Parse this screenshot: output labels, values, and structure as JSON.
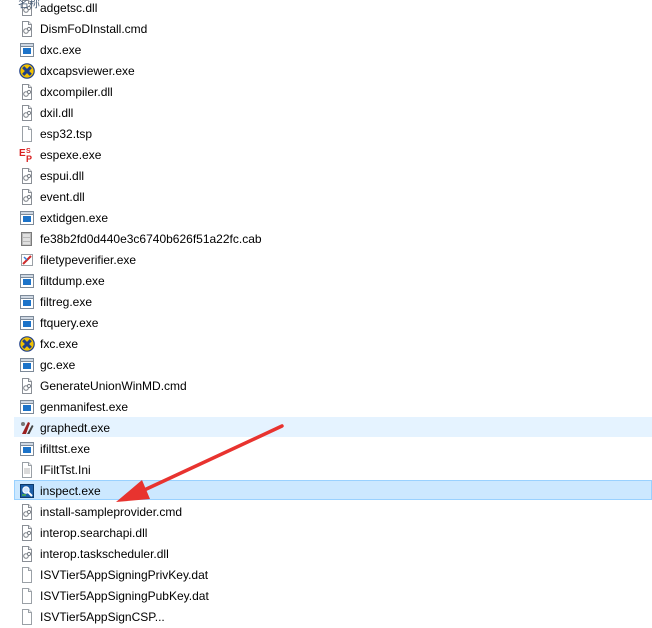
{
  "header": {
    "column_name": "名称"
  },
  "files": [
    {
      "name": "adgetsc.dll",
      "icon": "dll-file-icon",
      "state": "normal"
    },
    {
      "name": "DismFoDInstall.cmd",
      "icon": "cmd-file-icon",
      "state": "normal"
    },
    {
      "name": "dxc.exe",
      "icon": "exe-app-icon",
      "state": "normal"
    },
    {
      "name": "dxcapsviewer.exe",
      "icon": "directx-icon",
      "state": "normal"
    },
    {
      "name": "dxcompiler.dll",
      "icon": "dll-file-icon",
      "state": "normal"
    },
    {
      "name": "dxil.dll",
      "icon": "dll-file-icon",
      "state": "normal"
    },
    {
      "name": "esp32.tsp",
      "icon": "blank-file-icon",
      "state": "normal"
    },
    {
      "name": "espexe.exe",
      "icon": "esp-app-icon",
      "state": "normal"
    },
    {
      "name": "espui.dll",
      "icon": "dll-file-icon",
      "state": "normal"
    },
    {
      "name": "event.dll",
      "icon": "dll-file-icon",
      "state": "normal"
    },
    {
      "name": "extidgen.exe",
      "icon": "exe-app-icon",
      "state": "normal"
    },
    {
      "name": "fe38b2fd0d440e3c6740b626f51a22fc.cab",
      "icon": "cab-archive-icon",
      "state": "normal"
    },
    {
      "name": "filetypeverifier.exe",
      "icon": "verifier-app-icon",
      "state": "normal"
    },
    {
      "name": "filtdump.exe",
      "icon": "exe-app-icon",
      "state": "normal"
    },
    {
      "name": "filtreg.exe",
      "icon": "exe-app-icon",
      "state": "normal"
    },
    {
      "name": "ftquery.exe",
      "icon": "exe-app-icon",
      "state": "normal"
    },
    {
      "name": "fxc.exe",
      "icon": "directx-icon",
      "state": "normal"
    },
    {
      "name": "gc.exe",
      "icon": "exe-app-icon",
      "state": "normal"
    },
    {
      "name": "GenerateUnionWinMD.cmd",
      "icon": "cmd-file-icon",
      "state": "normal"
    },
    {
      "name": "genmanifest.exe",
      "icon": "exe-app-icon",
      "state": "normal"
    },
    {
      "name": "graphedt.exe",
      "icon": "graphedit-icon",
      "state": "hover"
    },
    {
      "name": "ifilttst.exe",
      "icon": "exe-app-icon",
      "state": "normal"
    },
    {
      "name": "IFiltTst.Ini",
      "icon": "ini-file-icon",
      "state": "normal"
    },
    {
      "name": "inspect.exe",
      "icon": "inspect-app-icon",
      "state": "selected"
    },
    {
      "name": "install-sampleprovider.cmd",
      "icon": "cmd-file-icon",
      "state": "normal"
    },
    {
      "name": "interop.searchapi.dll",
      "icon": "dll-file-icon",
      "state": "normal"
    },
    {
      "name": "interop.taskscheduler.dll",
      "icon": "dll-file-icon",
      "state": "normal"
    },
    {
      "name": "ISVTier5AppSigningPrivKey.dat",
      "icon": "blank-file-icon",
      "state": "normal"
    },
    {
      "name": "ISVTier5AppSigningPubKey.dat",
      "icon": "blank-file-icon",
      "state": "normal"
    },
    {
      "name": "ISVTier5AppSignCSP...",
      "icon": "blank-file-icon",
      "state": "normal"
    }
  ],
  "annotation": {
    "arrow_color": "#e8332f"
  }
}
